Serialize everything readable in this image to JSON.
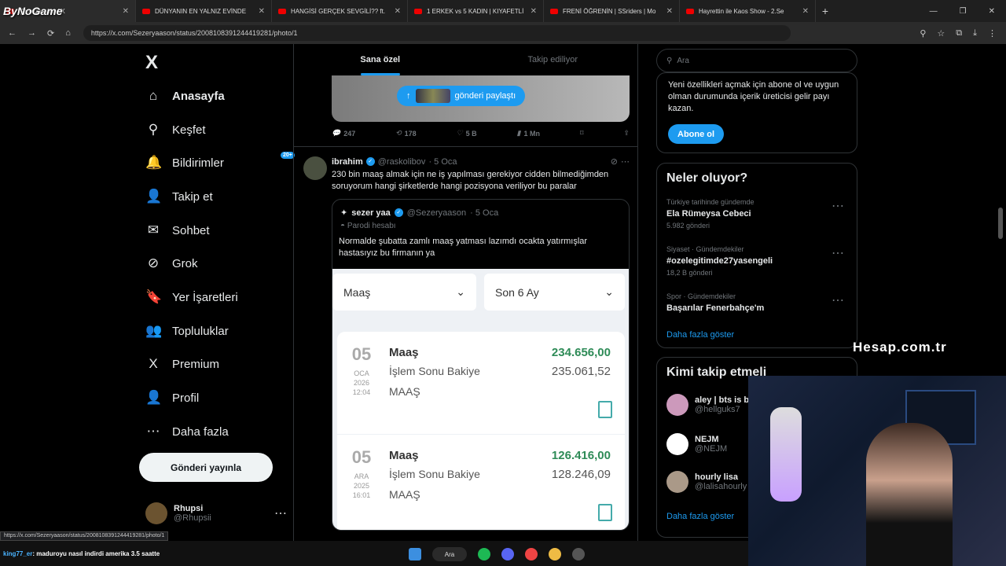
{
  "browser": {
    "tabs": [
      {
        "title": "(2) sezer yaa / X",
        "active": true
      },
      {
        "title": "DÜNYANIN EN YALNIZ EVİNDE",
        "active": false
      },
      {
        "title": "HANGİSİ GERÇEK SEVGİLİ?? ft.",
        "active": false
      },
      {
        "title": "1 ERKEK vs 5 KADIN | KIYAFETLİ",
        "active": false
      },
      {
        "title": "FRENİ ÖĞRENİN | SSriders | Mo",
        "active": false
      },
      {
        "title": "Hayrettin ile Kaos Show - 2.Se",
        "active": false
      }
    ],
    "new_tab": "+",
    "url": "https://x.com/Sezeryaason/status/2008108391244419281/photo/1",
    "overlay_logo": "ByNoGame"
  },
  "sidebar": {
    "logo": "X",
    "items": [
      {
        "label": "Anasayfa",
        "icon": "home-icon",
        "glyph": "⌂",
        "bold": true
      },
      {
        "label": "Keşfet",
        "icon": "search-icon",
        "glyph": "⚲"
      },
      {
        "label": "Bildirimler",
        "icon": "bell-icon",
        "glyph": "🔔"
      },
      {
        "label": "Takip et",
        "icon": "follow-icon",
        "glyph": "👤"
      },
      {
        "label": "Sohbet",
        "icon": "mail-icon",
        "glyph": "✉"
      },
      {
        "label": "Grok",
        "icon": "grok-icon",
        "glyph": "⊘"
      },
      {
        "label": "Yer İşaretleri",
        "icon": "bookmark-icon",
        "glyph": "🔖"
      },
      {
        "label": "Topluluklar",
        "icon": "communities-icon",
        "glyph": "👥"
      },
      {
        "label": "Premium",
        "icon": "x-premium-icon",
        "glyph": "X"
      },
      {
        "label": "Profil",
        "icon": "profile-icon",
        "glyph": "👤"
      },
      {
        "label": "Daha fazla",
        "icon": "more-circle-icon",
        "glyph": "⋯"
      }
    ],
    "notif_badge": "20+",
    "post_button": "Gönderi yayınla",
    "profile": {
      "name": "Rhupsi",
      "handle": "@Rhupsii",
      "more": "⋯"
    }
  },
  "main": {
    "tabs": [
      "Sana özel",
      "Takip ediliyor"
    ],
    "share_pill": "gönderi paylaştı",
    "prev_actions": {
      "reply": "247",
      "repost": "178",
      "like": "5 B",
      "views": "1 Mn"
    },
    "tweet": {
      "name": "ibrahim",
      "handle": "@raskolibov",
      "time": "· 5 Oca",
      "text": "230 bin maaş almak için ne iş yapılması gerekiyor cidden bilmediğimden soruyorum hangi şirketlerde hangi pozisyona veriliyor bu paralar",
      "quote": {
        "name": "sezer yaa",
        "handle": "@Sezeryaason",
        "time": "· 5 Oca",
        "parody": "Parodi hesabı",
        "text": "Normalde şubatta zamlı maaş yatması lazımdı ocakta yatırmışlar hastasıyız bu firmanın ya",
        "bank": {
          "dropdown1": "Maaş",
          "dropdown2": "Son 6 Ay",
          "entries": [
            {
              "day": "05",
              "month": "OCA",
              "year": "2026",
              "time": "12:04",
              "title": "Maaş",
              "sub": "İşlem Sonu Bakiye",
              "type": "MAAŞ",
              "amount": "234.656,00",
              "balance": "235.061,52"
            },
            {
              "day": "05",
              "month": "ARA",
              "year": "2025",
              "time": "16:01",
              "title": "Maaş",
              "sub": "İşlem Sonu Bakiye",
              "type": "MAAŞ",
              "amount": "126.416,00",
              "balance": "128.246,09"
            }
          ]
        }
      }
    }
  },
  "right": {
    "search_placeholder": "Ara",
    "premium_text": "Yeni özellikleri açmak için abone ol ve uygun olman durumunda içerik üreticisi gelir payı kazan.",
    "subscribe": "Abone ol",
    "trends_title": "Neler oluyor?",
    "trends": [
      {
        "cat": "Türkiye tarihinde gündemde",
        "name": "Ela Rümeysa Cebeci",
        "count": "5.982 gönderi"
      },
      {
        "cat": "Siyaset · Gündemdekiler",
        "name": "#ozelegitimde27yasengeli",
        "count": "18,2 B gönderi"
      },
      {
        "cat": "Spor · Gündemdekiler",
        "name": "Başarılar Fenerbahçe'm",
        "count": ""
      }
    ],
    "show_more": "Daha fazla göster",
    "follow_title": "Kimi takip etmeli",
    "follow": [
      {
        "name": "aley | bts is ba",
        "handle": "@hellguks7"
      },
      {
        "name": "NEJM",
        "handle": "@NEJM"
      },
      {
        "name": "hourly lisa",
        "handle": "@lalisahourly"
      }
    ],
    "follow_more": "Daha fazla göster"
  },
  "stream_overlay": "Hesap.com.tr",
  "status_url": "https://x.com/Sezeryaason/status/2008108391244419281/photo/1",
  "taskbar": {
    "chat_user": "king77_er",
    "chat_msg": ": maduroyu nasıl indirdi amerika 3.5 saatte",
    "search": "Ara"
  }
}
